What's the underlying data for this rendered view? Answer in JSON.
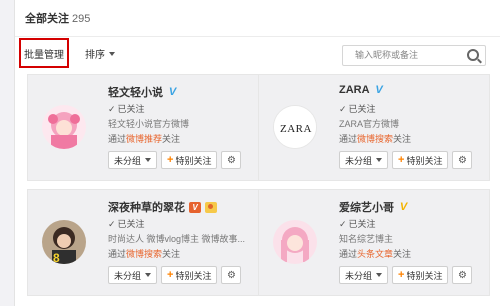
{
  "header": {
    "title": "全部关注",
    "count": "295"
  },
  "toolbar": {
    "batch_label": "批量管理",
    "sort_label": "排序",
    "search_placeholder": "输入昵称或备注"
  },
  "cards": [
    {
      "name": "轻文轻小说",
      "followed": "已关注",
      "desc": "轻文轻小说官方微博",
      "via_prefix": "通过",
      "via_source": "微博推荐",
      "via_suffix": "关注",
      "group": "未分组",
      "special": "特别关注"
    },
    {
      "name": "ZARA",
      "followed": "已关注",
      "desc": "ZARA官方微博",
      "via_prefix": "通过",
      "via_source": "微博搜索",
      "via_suffix": "关注",
      "group": "未分组",
      "special": "特别关注"
    },
    {
      "name": "深夜种草的翠花",
      "followed": "已关注",
      "desc": "时尚达人 微博vlog博主 微博故事...",
      "via_prefix": "通过",
      "via_source": "微博搜索",
      "via_suffix": "关注",
      "group": "未分组",
      "special": "特别关注"
    },
    {
      "name": "爱综艺小哥",
      "followed": "已关注",
      "desc": "知名综艺博主",
      "via_prefix": "通过",
      "via_source": "头条文章",
      "via_suffix": "关注",
      "group": "未分组",
      "special": "特别关注"
    }
  ],
  "zara_logo_text": "ZARA",
  "colors": {
    "accent": "#ff8200",
    "source_link": "#e8652d",
    "highlight_box": "#d40000",
    "verified_blue": "#3aa3e3",
    "verified_gold": "#f3b300"
  }
}
